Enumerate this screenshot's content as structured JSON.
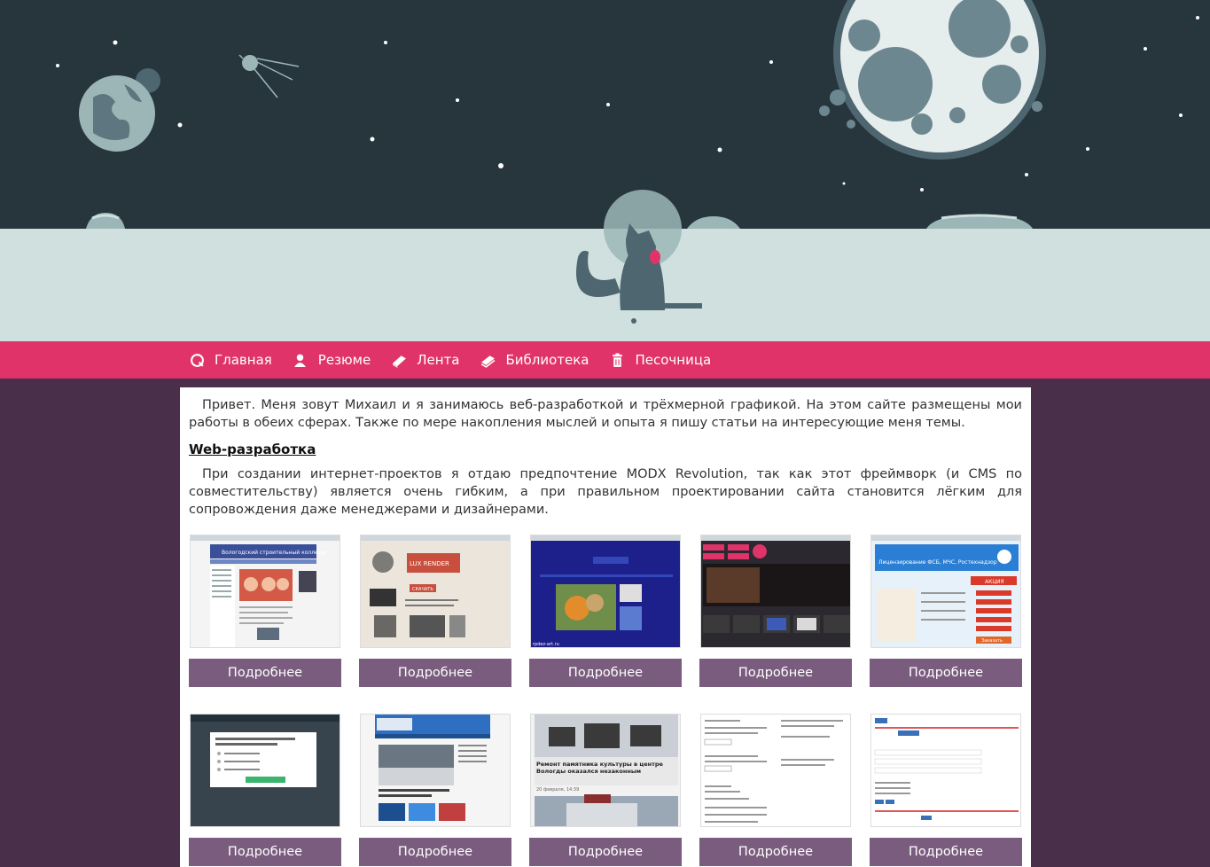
{
  "nav": {
    "items": [
      {
        "label": "Главная",
        "icon": "home-icon"
      },
      {
        "label": "Резюме",
        "icon": "user-icon"
      },
      {
        "label": "Лента",
        "icon": "book-icon"
      },
      {
        "label": "Библиотека",
        "icon": "book-stack-icon"
      },
      {
        "label": "Песочница",
        "icon": "trash-icon"
      }
    ]
  },
  "intro": "Привет. Меня зовут Михаил и я занимаюсь веб-разработкой и трёхмерной графикой. На этом сайте размещены мои работы в обеих сферах. Также по мере накопления мыслей и опыта я пишу статьи на интересующие меня темы.",
  "web_section": {
    "title": "Web-разработка",
    "text": "При создании интернет-проектов я отдаю предпочтение MODX Revolution, так как этот фреймворк (и CMS по совместительству) является очень гибким, а при правильном проектировании сайта становится лёгким для сопровождения даже менеджерами и дизайнерами."
  },
  "portfolio": {
    "button_label": "Подробнее",
    "items": [
      {
        "thumb": "college-site",
        "caption": "Вологодский строительный колледж"
      },
      {
        "thumb": "luxrender-site",
        "caption": "LUX RENDER",
        "button": "СКАЧАТЬ"
      },
      {
        "thumb": "dark-blue-site",
        "caption": "rpdez-art.ru"
      },
      {
        "thumb": "video-portal",
        "caption": ""
      },
      {
        "thumb": "license-site",
        "caption": "Лицензирование ФСБ, МЧС, Ростехнадзор",
        "badge": "АКЦИЯ",
        "order": "Заказать"
      },
      {
        "thumb": "quiz-dark",
        "caption": ""
      },
      {
        "thumb": "news-portal",
        "caption": ""
      },
      {
        "thumb": "news-article",
        "caption": "Ремонт памятника культуры в центре Вологды оказался незаконным",
        "date": "20 февраля, 14:39"
      },
      {
        "thumb": "form-page",
        "caption": ""
      },
      {
        "thumb": "table-page",
        "caption": ""
      }
    ]
  },
  "colors": {
    "sky": "#27353c",
    "ground": "#cfe0df",
    "nav": "#e0336a",
    "background": "#4a2f4a",
    "button": "#7a5d7e"
  }
}
